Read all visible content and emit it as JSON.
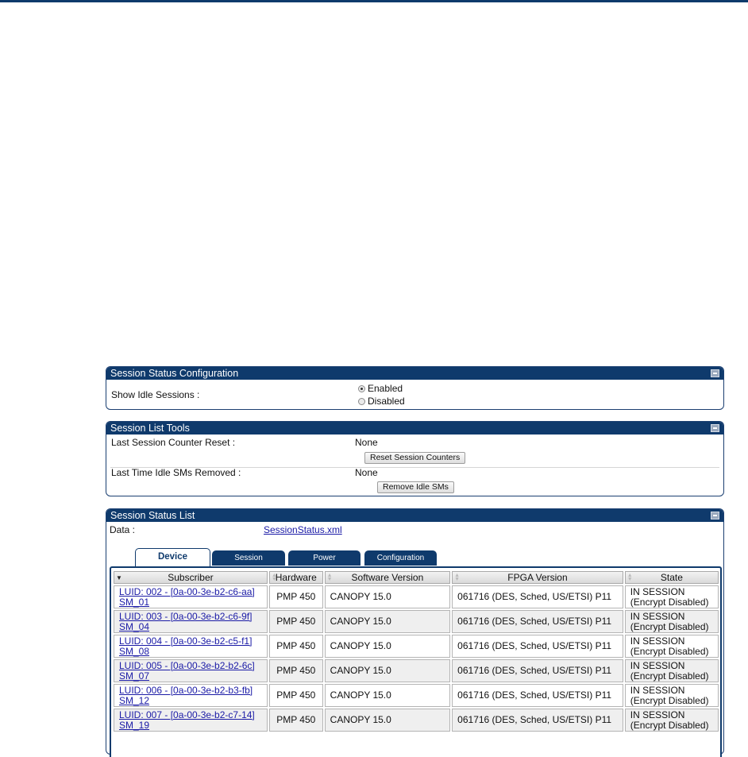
{
  "config_panel": {
    "title": "Session Status Configuration",
    "show_idle_label": "Show Idle Sessions :",
    "options": [
      "Enabled",
      "Disabled"
    ],
    "selected": "Enabled"
  },
  "tools_panel": {
    "title": "Session List Tools",
    "counter_reset_label": "Last Session Counter Reset :",
    "counter_reset_value": "None",
    "reset_button": "Reset Session Counters",
    "idle_removed_label": "Last Time Idle SMs Removed :",
    "idle_removed_value": "None",
    "remove_button": "Remove Idle SMs"
  },
  "list_panel": {
    "title": "Session Status List",
    "data_label": "Data :",
    "data_link": "SessionStatus.xml",
    "tabs": [
      "Device",
      "Session",
      "Power",
      "Configuration"
    ],
    "active_tab": "Device",
    "columns": [
      "Subscriber",
      "Hardware",
      "Software Version",
      "FPGA Version",
      "State"
    ],
    "rows": [
      {
        "luid": "LUID: 002 - [0a-00-3e-b2-c6-aa]",
        "sm": "SM_01",
        "hardware": "PMP 450",
        "software": "CANOPY 15.0",
        "fpga": "061716 (DES, Sched, US/ETSI) P11",
        "state1": "IN SESSION",
        "state2": "(Encrypt Disabled)"
      },
      {
        "luid": "LUID: 003 - [0a-00-3e-b2-c6-9f]",
        "sm": "SM_04",
        "hardware": "PMP 450",
        "software": "CANOPY 15.0",
        "fpga": "061716 (DES, Sched, US/ETSI) P11",
        "state1": "IN SESSION",
        "state2": "(Encrypt Disabled)"
      },
      {
        "luid": "LUID: 004 - [0a-00-3e-b2-c5-f1]",
        "sm": "SM_08",
        "hardware": "PMP 450",
        "software": "CANOPY 15.0",
        "fpga": "061716 (DES, Sched, US/ETSI) P11",
        "state1": "IN SESSION",
        "state2": "(Encrypt Disabled)"
      },
      {
        "luid": "LUID: 005 - [0a-00-3e-b2-b2-6c]",
        "sm": "SM_07",
        "hardware": "PMP 450",
        "software": "CANOPY 15.0",
        "fpga": "061716 (DES, Sched, US/ETSI) P11",
        "state1": "IN SESSION",
        "state2": "(Encrypt Disabled)"
      },
      {
        "luid": "LUID: 006 - [0a-00-3e-b2-b3-fb]",
        "sm": "SM_12",
        "hardware": "PMP 450",
        "software": "CANOPY 15.0",
        "fpga": "061716 (DES, Sched, US/ETSI) P11",
        "state1": "IN SESSION",
        "state2": "(Encrypt Disabled)"
      },
      {
        "luid": "LUID: 007 - [0a-00-3e-b2-c7-14]",
        "sm": "SM_19",
        "hardware": "PMP 450",
        "software": "CANOPY 15.0",
        "fpga": "061716 (DES, Sched, US/ETSI) P11",
        "state1": "IN SESSION",
        "state2": "(Encrypt Disabled)"
      }
    ]
  }
}
